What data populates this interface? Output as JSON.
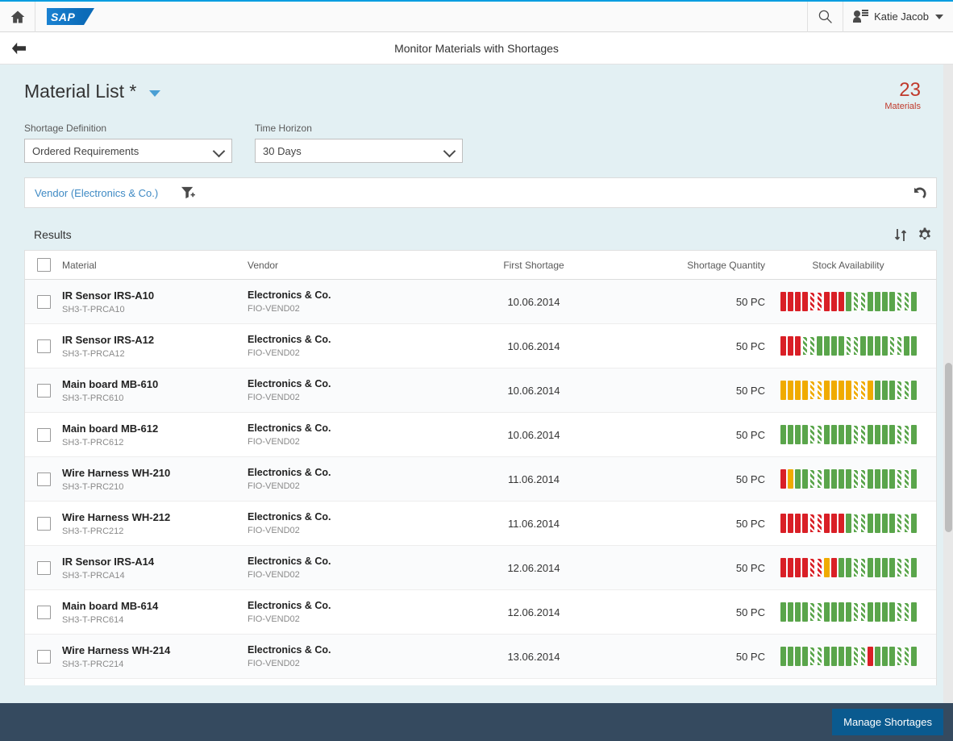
{
  "shell": {
    "home_icon": "home-icon",
    "logo_text": "SAP",
    "search_icon": "search-icon",
    "user_name": "Katie Jacob",
    "user_icon": "user-icon",
    "caret_icon": "chevron-down-icon"
  },
  "page": {
    "back_icon": "back-arrow-icon",
    "title": "Monitor Materials with Shortages"
  },
  "variant": {
    "title": "Material List *",
    "chevron_icon": "chevron-down-icon",
    "count": "23",
    "count_label": "Materials"
  },
  "filters": {
    "shortage_definition": {
      "label": "Shortage Definition",
      "value": "Ordered Requirements",
      "arrow_icon": "chevron-down-icon"
    },
    "time_horizon": {
      "label": "Time Horizon",
      "value": "30 Days",
      "arrow_icon": "chevron-down-icon"
    }
  },
  "filterbar": {
    "active_filter": "Vendor (Electronics & Co.)",
    "add_filter_icon": "filter-add-icon",
    "reset_icon": "undo-icon"
  },
  "results": {
    "title": "Results",
    "sort_icon": "sort-icon",
    "settings_icon": "gear-icon",
    "columns": {
      "material": "Material",
      "vendor": "Vendor",
      "first_shortage": "First Shortage",
      "shortage_quantity": "Shortage Quantity",
      "stock_availability": "Stock Availability"
    },
    "rows": [
      {
        "material_name": "IR Sensor IRS-A10",
        "material_id": "SH3-T-PRCA10",
        "vendor_name": "Electronics & Co.",
        "vendor_id": "FIO-VEND02",
        "first_shortage": "10.06.2014",
        "shortage_quantity": "50 PC",
        "stock_bars": [
          "red",
          "red",
          "red",
          "red",
          "red-h",
          "red-h",
          "red",
          "red",
          "red",
          "green",
          "green-h",
          "green-h",
          "green",
          "green",
          "green",
          "green",
          "green-h",
          "green-h",
          "green"
        ]
      },
      {
        "material_name": "IR Sensor IRS-A12",
        "material_id": "SH3-T-PRCA12",
        "vendor_name": "Electronics & Co.",
        "vendor_id": "FIO-VEND02",
        "first_shortage": "10.06.2014",
        "shortage_quantity": "50 PC",
        "stock_bars": [
          "red",
          "red",
          "red",
          "green-h",
          "green-h",
          "green",
          "green",
          "green",
          "green",
          "green-h",
          "green-h",
          "green",
          "green",
          "green",
          "green",
          "green-h",
          "green-h",
          "green",
          "green"
        ]
      },
      {
        "material_name": "Main board MB-610",
        "material_id": "SH3-T-PRC610",
        "vendor_name": "Electronics & Co.",
        "vendor_id": "FIO-VEND02",
        "first_shortage": "10.06.2014",
        "shortage_quantity": "50 PC",
        "stock_bars": [
          "orange",
          "orange",
          "orange",
          "orange",
          "orange-h",
          "orange-h",
          "orange",
          "orange",
          "orange",
          "orange",
          "orange-h",
          "orange-h",
          "orange",
          "green",
          "green",
          "green",
          "green-h",
          "green-h",
          "green"
        ]
      },
      {
        "material_name": "Main board MB-612",
        "material_id": "SH3-T-PRC612",
        "vendor_name": "Electronics & Co.",
        "vendor_id": "FIO-VEND02",
        "first_shortage": "10.06.2014",
        "shortage_quantity": "50 PC",
        "stock_bars": [
          "green",
          "green",
          "green",
          "green",
          "green-h",
          "green-h",
          "green",
          "green",
          "green",
          "green",
          "green-h",
          "green-h",
          "green",
          "green",
          "green",
          "green",
          "green-h",
          "green-h",
          "green"
        ]
      },
      {
        "material_name": "Wire Harness WH-210",
        "material_id": "SH3-T-PRC210",
        "vendor_name": "Electronics & Co.",
        "vendor_id": "FIO-VEND02",
        "first_shortage": "11.06.2014",
        "shortage_quantity": "50 PC",
        "stock_bars": [
          "red",
          "orange",
          "green",
          "green",
          "green-h",
          "green-h",
          "green",
          "green",
          "green",
          "green",
          "green-h",
          "green-h",
          "green",
          "green",
          "green",
          "green",
          "green-h",
          "green-h",
          "green"
        ]
      },
      {
        "material_name": "Wire Harness WH-212",
        "material_id": "SH3-T-PRC212",
        "vendor_name": "Electronics & Co.",
        "vendor_id": "FIO-VEND02",
        "first_shortage": "11.06.2014",
        "shortage_quantity": "50 PC",
        "stock_bars": [
          "red",
          "red",
          "red",
          "red",
          "red-h",
          "red-h",
          "red",
          "red",
          "red",
          "green",
          "green-h",
          "green-h",
          "green",
          "green",
          "green",
          "green",
          "green-h",
          "green-h",
          "green"
        ]
      },
      {
        "material_name": "IR Sensor IRS-A14",
        "material_id": "SH3-T-PRCA14",
        "vendor_name": "Electronics & Co.",
        "vendor_id": "FIO-VEND02",
        "first_shortage": "12.06.2014",
        "shortage_quantity": "50 PC",
        "stock_bars": [
          "red",
          "red",
          "red",
          "red",
          "red-h",
          "red-h",
          "orange",
          "red",
          "green",
          "green",
          "green-h",
          "green-h",
          "green",
          "green",
          "green",
          "green",
          "green-h",
          "green-h",
          "green"
        ]
      },
      {
        "material_name": "Main board MB-614",
        "material_id": "SH3-T-PRC614",
        "vendor_name": "Electronics & Co.",
        "vendor_id": "FIO-VEND02",
        "first_shortage": "12.06.2014",
        "shortage_quantity": "50 PC",
        "stock_bars": [
          "green",
          "green",
          "green",
          "green",
          "green-h",
          "green-h",
          "green",
          "green",
          "green",
          "green",
          "green-h",
          "green-h",
          "green",
          "green",
          "green",
          "green",
          "green-h",
          "green-h",
          "green"
        ]
      },
      {
        "material_name": "Wire Harness WH-214",
        "material_id": "SH3-T-PRC214",
        "vendor_name": "Electronics & Co.",
        "vendor_id": "FIO-VEND02",
        "first_shortage": "13.06.2014",
        "shortage_quantity": "50 PC",
        "stock_bars": [
          "green",
          "green",
          "green",
          "green",
          "green-h",
          "green-h",
          "green",
          "green",
          "green",
          "green",
          "green-h",
          "green-h",
          "red",
          "green",
          "green",
          "green",
          "green-h",
          "green-h",
          "green"
        ]
      }
    ]
  },
  "footer": {
    "primary_action": "Manage Shortages"
  },
  "colors": {
    "accent": "#009de0",
    "danger": "#d91f26",
    "warning": "#f0ab00",
    "success": "#5aa54b",
    "counter": "#c0392b",
    "footer_bg": "#354a5f",
    "footer_btn": "#0a5a8f"
  }
}
